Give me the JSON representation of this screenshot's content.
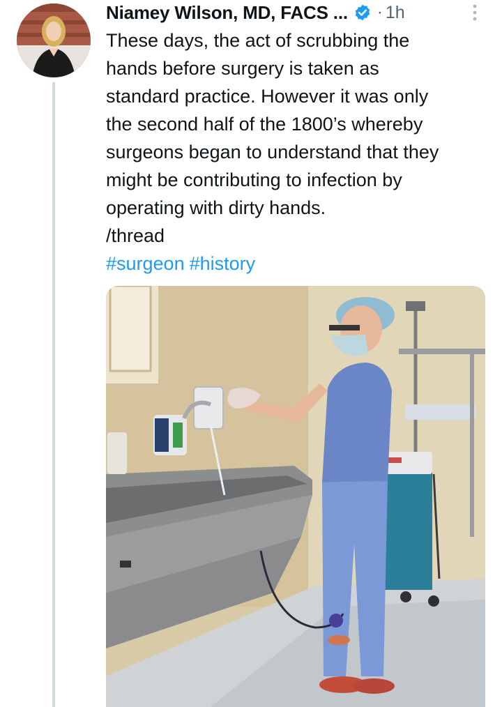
{
  "author": {
    "display_name": "Niamey Wilson, MD, FACS ...",
    "verified_badge_icon": "verified-badge-icon",
    "time_separator": "·",
    "timestamp": "1h",
    "more_icon": "more-vertical-icon"
  },
  "tweet": {
    "lines": [
      "These days, the act of scrubbing the",
      "hands before surgery is taken as",
      "standard practice. However it was only",
      "the second half of the 1800’s whereby",
      "surgeons began to understand that they",
      "might be contributing to infection by",
      "operating with dirty hands.",
      "/thread"
    ],
    "hashtags": [
      "#surgeon",
      "#history"
    ]
  },
  "colors": {
    "link": "#1d9bf0",
    "verified": "#1d9bf0",
    "secondary_text": "#536471",
    "thread_line": "#cfd9de"
  }
}
